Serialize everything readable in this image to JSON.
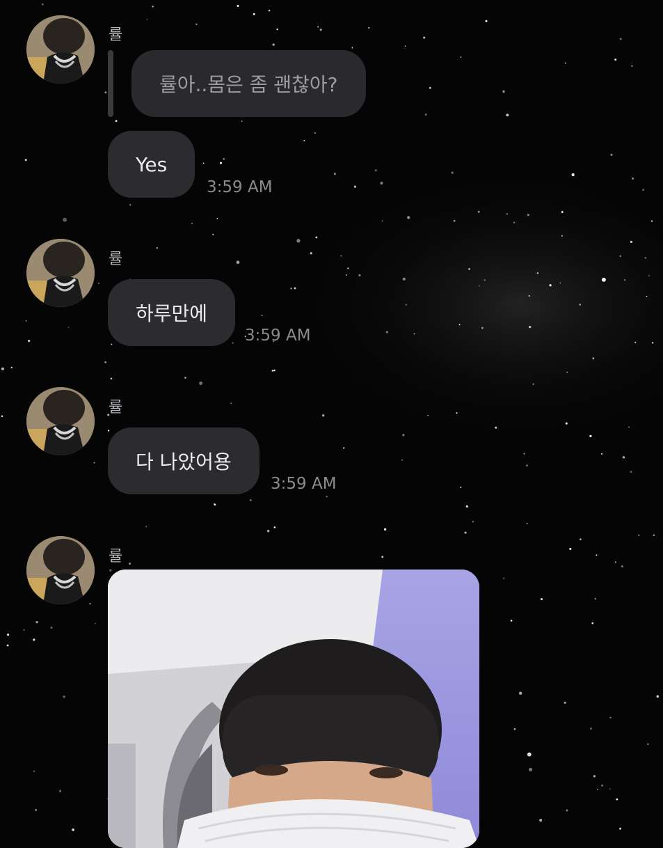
{
  "chat": {
    "messages": [
      {
        "sender": "률",
        "quote": "률아..몸은 좀 괜찮아?",
        "text": "Yes",
        "time": "3:59 AM"
      },
      {
        "sender": "률",
        "text": "하루만에",
        "time": "3:59 AM"
      },
      {
        "sender": "률",
        "text": "다 나았어용",
        "time": "3:59 AM"
      },
      {
        "sender": "률",
        "attachment": "photo"
      }
    ]
  },
  "colors": {
    "background": "#050505",
    "bubble": "#2c2c30",
    "bubble_text": "#ececee",
    "timestamp": "#8a8a90",
    "sender_name": "#b8b8bc"
  }
}
